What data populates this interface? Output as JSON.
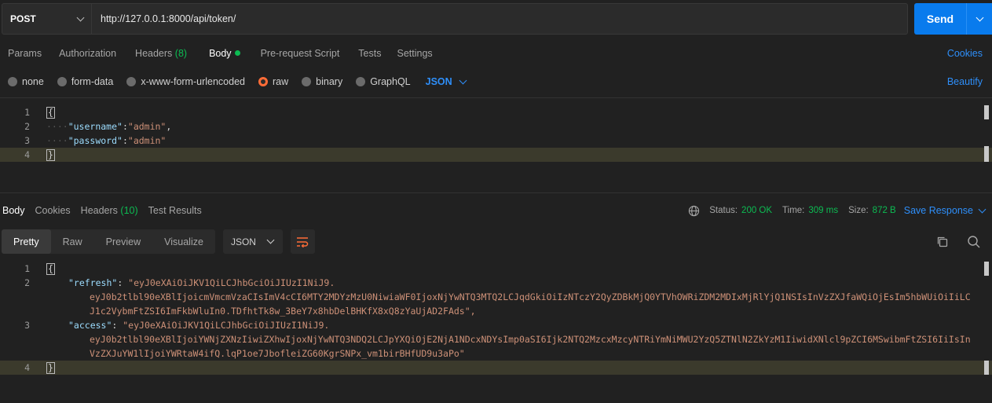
{
  "request": {
    "method": "POST",
    "url": "http://127.0.0.1:8000/api/token/",
    "send_label": "Send"
  },
  "request_tabs": {
    "params": "Params",
    "authorization": "Authorization",
    "headers": "Headers",
    "headers_count": "(8)",
    "body": "Body",
    "prerequest": "Pre-request Script",
    "tests": "Tests",
    "settings": "Settings",
    "cookies": "Cookies"
  },
  "body_types": {
    "none": "none",
    "form_data": "form-data",
    "urlencoded": "x-www-form-urlencoded",
    "raw": "raw",
    "binary": "binary",
    "graphql": "GraphQL",
    "language": "JSON",
    "beautify": "Beautify"
  },
  "request_body": {
    "line_numbers": [
      "1",
      "2",
      "3",
      "4"
    ],
    "open_brace": "{",
    "close_brace": "}",
    "username_key": "\"username\"",
    "username_value": "\"admin\"",
    "password_key": "\"password\"",
    "password_value": "\"admin\""
  },
  "response_tabs": {
    "body": "Body",
    "cookies": "Cookies",
    "headers": "Headers",
    "headers_count": "(10)",
    "test_results": "Test Results"
  },
  "response_status": {
    "status_label": "Status:",
    "status_value": "200 OK",
    "time_label": "Time:",
    "time_value": "309 ms",
    "size_label": "Size:",
    "size_value": "872 B",
    "save_response": "Save Response"
  },
  "view_modes": {
    "pretty": "Pretty",
    "raw": "Raw",
    "preview": "Preview",
    "visualize": "Visualize",
    "format": "JSON"
  },
  "response_body": {
    "line_numbers": [
      "1",
      "2",
      "3",
      "4"
    ],
    "open_brace": "{",
    "close_brace": "}",
    "refresh_key": "\"refresh\"",
    "refresh_value_1": "\"eyJ0eXAiOiJKV1QiLCJhbGciOiJIUzI1NiJ9.",
    "refresh_value_2": "eyJ0b2tlbl90eXBlIjoicmVmcmVzaCIsImV4cCI6MTY2MDYzMzU0NiwiaWF0IjoxNjYwNTQ3MTQ2LCJqdGkiOiIzNTczY2QyZDBkMjQ0YTVhOWRiZDM2MDIxMjRlYjQ1NSIsInVzZXJfaWQiOjEsIm5hbWUiOiIiLC",
    "refresh_value_3": "J1c2VybmFtZSI6ImFkbWluIn0.TDfhtTk8w_3BeY7x8hbDelBHKfX8xQ8zYaUjAD2FAds\",",
    "access_key": "\"access\"",
    "access_value_1": "\"eyJ0eXAiOiJKV1QiLCJhbGciOiJIUzI1NiJ9.",
    "access_value_2": "eyJ0b2tlbl90eXBlIjoiYWNjZXNzIiwiZXhwIjoxNjYwNTQ3NDQ2LCJpYXQiOjE2NjA1NDcxNDYsImp0aSI6Ijk2NTQ2MzcxMzcyNTRiYmNiMWU2YzQ5ZTNlN2ZkYzM1IiwidXNlcl9pZCI6MSwibmFtZSI6IiIsIn",
    "access_value_3": "VzZXJuYW1lIjoiYWRtaW4ifQ.lqP1oe7JbofleiZG60KgrSNPx_vm1birBHfUD9u3aPo\""
  },
  "colors": {
    "accent": "#097bed",
    "link": "#2e8ffa",
    "success": "#0cbb52",
    "radio_active": "#ff6c37",
    "json_key": "#9cdcfe",
    "json_string": "#ce9178"
  },
  "icons": {
    "method_dropdown": "chevron-down-icon",
    "send_dropdown": "chevron-down-icon",
    "globe": "globe-icon",
    "wrap": "wrap-lines-icon",
    "copy": "copy-icon",
    "search": "search-icon"
  }
}
